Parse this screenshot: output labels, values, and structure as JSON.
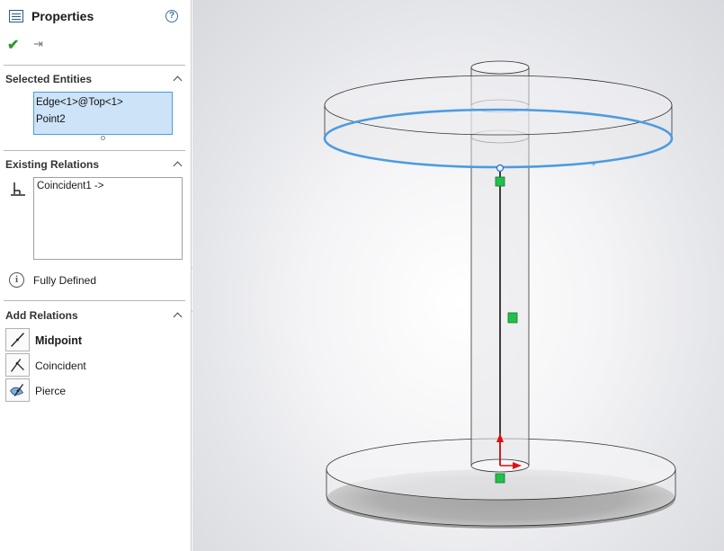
{
  "panel": {
    "title": "Properties",
    "help_icon": "help-circle-icon",
    "ok_icon": "checkmark-icon",
    "pin_icon": "pushpin-icon"
  },
  "selected_entities": {
    "title": "Selected Entities",
    "items": [
      "Edge<1>@Top<1>",
      "Point2"
    ]
  },
  "existing_relations": {
    "title": "Existing Relations",
    "items": [
      "Coincident1 ->"
    ]
  },
  "status": {
    "text": "Fully Defined"
  },
  "add_relations": {
    "title": "Add Relations",
    "items": [
      {
        "label": "Midpoint",
        "icon": "midpoint-icon"
      },
      {
        "label": "Coincident",
        "icon": "coincident-icon"
      },
      {
        "label": "Pierce",
        "icon": "pierce-icon"
      }
    ]
  },
  "colors": {
    "accent_blue": "#4d9be0",
    "selection_fill": "#cde3f7",
    "ok_green": "#2e9a2e",
    "constraint_green": "#22c04a",
    "arrow_red": "#e01010"
  }
}
